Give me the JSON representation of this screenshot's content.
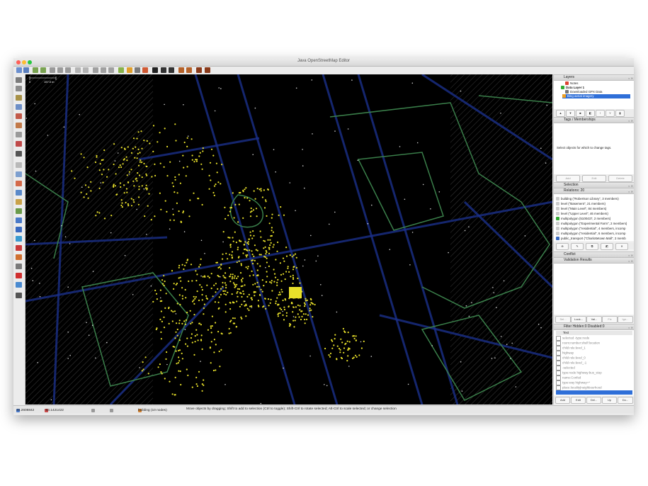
{
  "window": {
    "title": "Java OpenStreetMap Editor"
  },
  "map": {
    "scale_label": "157.0 m",
    "scale_zero": "0"
  },
  "layers": {
    "header": "Layers",
    "items": [
      {
        "label": "Notes"
      },
      {
        "label": "Data Layer 1"
      },
      {
        "label": "Downloaded GPX Data"
      },
      {
        "label": "Bing aerial imagery"
      }
    ]
  },
  "tags": {
    "header": "Tags / Memberships",
    "message": "Select objects for which to change tags.",
    "add_label": "Add",
    "edit_label": "Edit",
    "delete_label": "Delete"
  },
  "selection": {
    "header": "Selection"
  },
  "relations": {
    "header": "Relations: 20",
    "items": [
      {
        "label": "building (\"Robertson Library\", 3 members)"
      },
      {
        "label": "level (\"Basement\", 21 members)"
      },
      {
        "label": "level (\"Main Level\", 84 members)"
      },
      {
        "label": "level (\"Upper Level\", 46 members)"
      },
      {
        "label": "multipolygon (5100437, 2 members)"
      },
      {
        "label": "multipolygon (\"Experimental Farm\", 2 members)"
      },
      {
        "label": "multipolygon (\"residential\", 4 members, incomp"
      },
      {
        "label": "multipolygon (\"residential\", 6 members, incomp"
      },
      {
        "label": "public_transport (\"Charlottetown Mall\", 2 memb"
      }
    ]
  },
  "conflict": {
    "header": "Conflict"
  },
  "validation": {
    "header": "Validation Results",
    "buttons": [
      "Sel...",
      "Look...",
      "Val...",
      "Fix",
      "Ign..."
    ]
  },
  "filter": {
    "header": "Filter Hidden:0 Disabled:0",
    "text_col": "Text",
    "items": [
      {
        "label": "selected -type:node"
      },
      {
        "label": "room:number:shelf:location"
      },
      {
        "label": "child role:level_1"
      },
      {
        "label": "highway"
      },
      {
        "label": "child role:level_0"
      },
      {
        "label": "child role:level_-1"
      },
      {
        "label": "-selected"
      },
      {
        "label": "type:node highway:bus_stop"
      },
      {
        "label": "name:Confed"
      },
      {
        "label": "type:way highway=*"
      },
      {
        "label": "place:locality|neighbourhood"
      },
      {
        "label": ""
      }
    ],
    "add_label": "Add",
    "edit_label": "Edit",
    "delete_label": "Del...",
    "up_label": "Up",
    "down_label": "Do..."
  },
  "status": {
    "lat": "46.2608842",
    "lon": "-63.1421422",
    "angle": "",
    "distance": "",
    "selection": "building (10 nodes)",
    "help": "Move objects by dragging; Shift to add to selection (Ctrl to toggle); Shift-Ctrl to rotate selected; Alt-Ctrl to scale selected; or change selection"
  },
  "colors": {
    "map_bg": "#000000",
    "ways": "#1a2f8a",
    "outline": "#3a7f4a",
    "nodes": "#e8e02a",
    "selected_layer": "#2f6fd8"
  }
}
